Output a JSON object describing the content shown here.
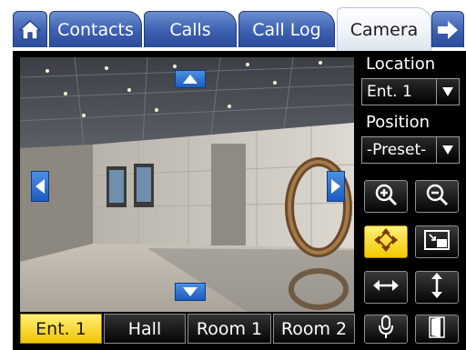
{
  "tabs": [
    {
      "id": "home",
      "icon": "home-icon"
    },
    {
      "id": "contacts",
      "label": "Contacts"
    },
    {
      "id": "calls",
      "label": "Calls"
    },
    {
      "id": "call_log",
      "label": "Call Log"
    },
    {
      "id": "camera",
      "label": "Camera",
      "active": true
    },
    {
      "id": "next",
      "icon": "arrow-right-icon"
    }
  ],
  "location": {
    "label": "Location",
    "value": "Ent. 1"
  },
  "position": {
    "label": "Position",
    "value": "-Preset-"
  },
  "presets": [
    {
      "label": "Ent. 1",
      "active": true
    },
    {
      "label": "Hall"
    },
    {
      "label": "Room 1"
    },
    {
      "label": "Room 2"
    }
  ],
  "controls": [
    {
      "icon": "zoom-in-icon"
    },
    {
      "icon": "zoom-out-icon"
    },
    {
      "icon": "pan-move-icon",
      "active": true
    },
    {
      "icon": "picture-in-picture-icon"
    },
    {
      "icon": "horizontal-resize-icon"
    },
    {
      "icon": "vertical-resize-icon"
    },
    {
      "icon": "microphone-icon"
    },
    {
      "icon": "door-icon"
    }
  ],
  "colors": {
    "tab_blue": "#3c5fb0",
    "active_yellow": "#f3c800",
    "panel": "#000000"
  }
}
